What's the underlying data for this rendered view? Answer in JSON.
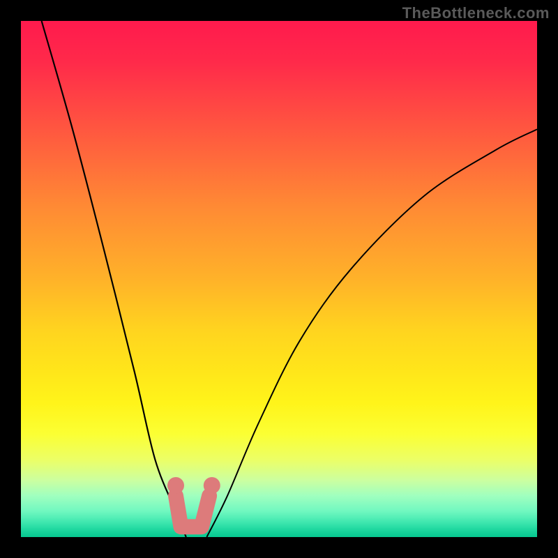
{
  "watermark": "TheBottleneck.com",
  "colors": {
    "background": "#000000",
    "curve_stroke": "#000000",
    "marker_fill": "#dd7b7b",
    "gradient_top": "#ff1a4d",
    "gradient_bottom": "#06c890"
  },
  "chart_data": {
    "type": "line",
    "title": "",
    "xlabel": "",
    "ylabel": "",
    "xlim": [
      0,
      100
    ],
    "ylim": [
      0,
      100
    ],
    "grid": false,
    "series": [
      {
        "name": "left-curve",
        "note": "steep descending branch from top-left into valley floor",
        "x": [
          4,
          10,
          16,
          22,
          26,
          30,
          32
        ],
        "y": [
          100,
          79,
          56,
          32,
          15,
          5,
          0
        ]
      },
      {
        "name": "right-curve",
        "note": "ascending branch from valley floor toward upper-right, shallower",
        "x": [
          36,
          40,
          46,
          54,
          64,
          78,
          92,
          100
        ],
        "y": [
          0,
          8,
          22,
          38,
          52,
          66,
          75,
          79
        ]
      }
    ],
    "valley_segment": {
      "note": "thick salmon L-shaped marker at valley bottom",
      "points": [
        {
          "x": 30,
          "y": 8
        },
        {
          "x": 31,
          "y": 2
        },
        {
          "x": 35,
          "y": 2
        },
        {
          "x": 36.5,
          "y": 8
        }
      ],
      "endpoint_dots": [
        {
          "x": 30,
          "y": 10
        },
        {
          "x": 37,
          "y": 10
        }
      ]
    },
    "gradient_meaning": "top = high bottleneck (red), bottom = zero bottleneck (green)"
  }
}
